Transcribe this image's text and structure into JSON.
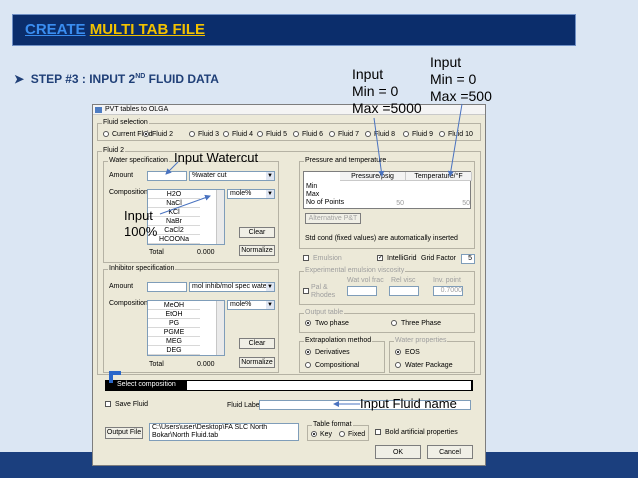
{
  "slide": {
    "title_part1": "CREATE",
    "title_part2": "MULTI TAB FILE",
    "step_prefix": "STEP #3 : INPUT 2",
    "step_sup": "ND",
    "step_suffix": " FLUID DATA"
  },
  "window": {
    "title": "PVT tables to OLGA",
    "fluid_selection": {
      "caption": "Fluid selection",
      "options": [
        "Current Fluid",
        "Fluid 2",
        "Fluid 3",
        "Fluid 4",
        "Fluid 5",
        "Fluid 6",
        "Fluid 7",
        "Fluid 8",
        "Fluid 9",
        "Fluid 10"
      ],
      "selected": "Fluid 2"
    },
    "fluid2_caption": "Fluid 2",
    "water_spec": {
      "caption": "Water specification",
      "amount_label": "Amount",
      "amount_value": "",
      "amount_unit": "%water cut",
      "composition_label": "Composition",
      "components": [
        "H2O",
        "NaCl",
        "KCl",
        "NaBr",
        "CaCl2",
        "HCOONa"
      ],
      "comp_unit": "mole%",
      "clear_label": "Clear",
      "total_label": "Total",
      "total_value": "0.000",
      "normalize_label": "Normalize"
    },
    "inhibitor_spec": {
      "caption": "Inhibitor specification",
      "amount_label": "Amount",
      "amount_value": "",
      "amount_unit": "mol inhib/mol spec water",
      "composition_label": "Composition",
      "components": [
        "MeOH",
        "EtOH",
        "PG",
        "PGME",
        "MEG",
        "DEG"
      ],
      "comp_unit": "mole%",
      "clear_label": "Clear",
      "total_label": "Total",
      "total_value": "0.000",
      "normalize_label": "Normalize"
    },
    "pressure_temp": {
      "caption": "Pressure and temperature",
      "col_pressure": "Pressure/psig",
      "col_temp": "Temperature/°F",
      "rows": [
        "Min",
        "Max",
        "No of Points"
      ],
      "points_pressure": "50",
      "points_temp": "50",
      "alt_button": "Alternative P&T",
      "note": "Std cond (fixed values) are automatically inserted"
    },
    "emulsion_label": "Emulsion",
    "intelligrid_label": "IntelliGrid",
    "grid_factor_label": "Grid Factor",
    "grid_factor_value": "5",
    "exp_emulsion": {
      "caption": "Experimental emulsion viscosity",
      "col1": "Wat vol frac",
      "col2": "Rel visc",
      "col3": "Inv. point",
      "inv_value": "0.7000",
      "pal_label": "Pal & Rhodes"
    },
    "output_table": {
      "caption": "Output table",
      "opt1": "Two phase",
      "opt2": "Three Phase"
    },
    "extrapolation": {
      "caption": "Extrapolation method",
      "opt1": "Derivatives",
      "opt2": "Compositional"
    },
    "water_props": {
      "caption": "Water properties",
      "opt1": "EOS",
      "opt2": "Water Package"
    },
    "select_composition": "Select composition",
    "save_fluid_label": "Save Fluid",
    "fluid_label_label": "Fluid Label",
    "fluid_label_value": "",
    "output_file_button": "Output File",
    "output_file_path": "C:\\Users\\user\\Desktop\\FA SLC North Bokar\\North Fluid.tab",
    "table_format": {
      "caption": "Table format",
      "opt1": "Key",
      "opt2": "Fixed"
    },
    "bold_label": "Bold artificial  properties",
    "ok_label": "OK",
    "cancel_label": "Cancel"
  },
  "annotations": {
    "input_watercut": "Input Watercut",
    "input_100": [
      "Input",
      "100%"
    ],
    "pressure_note": [
      "Input",
      "Min = 0",
      "Max =5000"
    ],
    "temp_note": [
      "Input",
      "Min = 0",
      "Max =500"
    ],
    "fluid_name_note": "Input Fluid name"
  },
  "colors": {
    "title_bg": "#0b2d6b",
    "title_accent_blue": "#3a8df0",
    "title_accent_yellow": "#f2c200",
    "step_text": "#1f3f77",
    "slide_bg": "#dbe6f3"
  }
}
